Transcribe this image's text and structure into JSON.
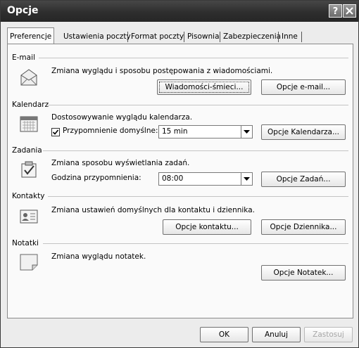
{
  "window": {
    "title": "Opcje"
  },
  "tabs": [
    "Preferencje",
    "Ustawienia poczty",
    "Format poczty",
    "Pisownia",
    "Zabezpieczenia",
    "Inne"
  ],
  "sections": {
    "email": {
      "header": "E-mail",
      "description": "Zmiana wyglądu i sposobu postępowania z wiadomościami.",
      "buttons": [
        "Wiadomości-śmieci...",
        "Opcje e-mail..."
      ]
    },
    "calendar": {
      "header": "Kalendarz",
      "description": "Dostosowywanie wyglądu kalendarza.",
      "reminder_label": "Przypomnienie domyślne:",
      "reminder_value": "15 min",
      "reminder_checked": true,
      "button": "Opcje Kalendarza..."
    },
    "tasks": {
      "header": "Zadania",
      "description": "Zmiana sposobu wyświetlania zadań.",
      "time_label": "Godzina przypomnienia:",
      "time_value": "08:00",
      "button": "Opcje Zadań..."
    },
    "contacts": {
      "header": "Kontakty",
      "description": "Zmiana ustawień domyślnych dla kontaktu i dziennika.",
      "buttons": [
        "Opcje kontaktu...",
        "Opcje Dziennika..."
      ]
    },
    "notes": {
      "header": "Notatki",
      "description": "Zmiana wyglądu notatek.",
      "button": "Opcje Notatek..."
    }
  },
  "footer": {
    "ok": "OK",
    "cancel": "Anuluj",
    "apply": "Zastosuj"
  }
}
